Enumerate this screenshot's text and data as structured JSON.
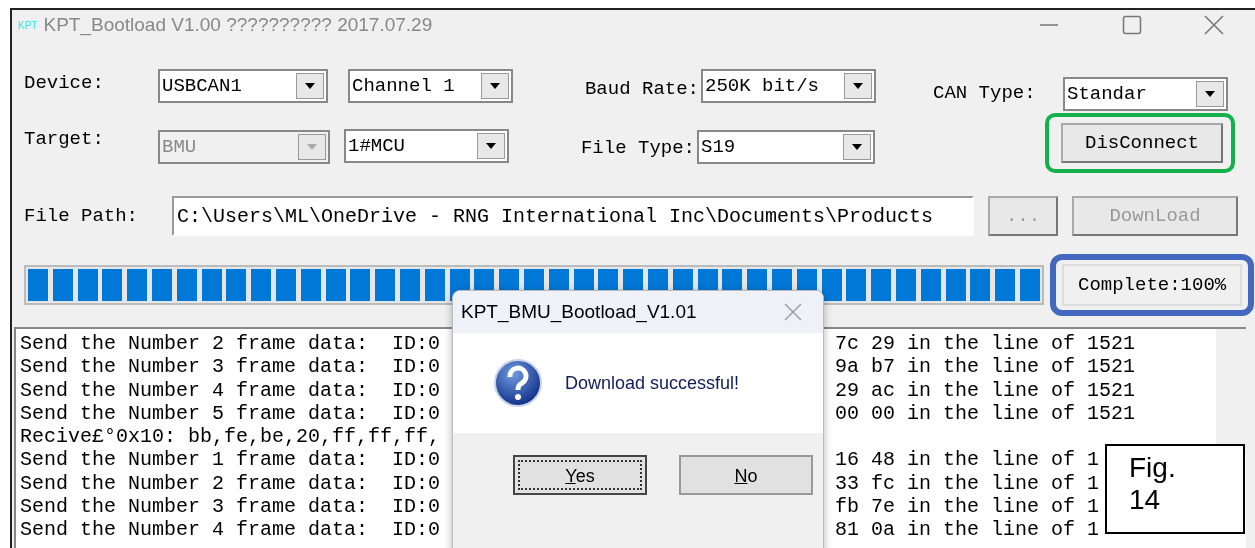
{
  "window": {
    "app_badge": "KPT",
    "title": "KPT_Bootload V1.00 ?????????? 2017.07.29"
  },
  "row1": {
    "label": "Device:",
    "device": {
      "value": "USBCAN1",
      "disabled": false
    },
    "channel": {
      "value": "Channel 1",
      "disabled": false
    },
    "baud_label": "Baud Rate:",
    "baud": {
      "value": "250K bit/s",
      "disabled": false
    },
    "can_label": "CAN Type:",
    "can_type": {
      "value": "Standar",
      "disabled": false
    }
  },
  "row2": {
    "label": "Target:",
    "target": {
      "value": "BMU",
      "disabled": true
    },
    "mcu": {
      "value": "1#MCU",
      "disabled": false
    },
    "file_type_label": "File Type:",
    "file_type": {
      "value": "S19",
      "disabled": false
    },
    "connect_button": {
      "label": "DisConnect",
      "disabled": false,
      "highlighted": true
    }
  },
  "file_path": {
    "label": "File Path:",
    "value": "C:\\Users\\ML\\OneDrive - RNG International Inc\\Documents\\Products",
    "browse_button": {
      "label": "...",
      "disabled": true
    },
    "download_button": {
      "label": "DownLoad",
      "disabled": true
    }
  },
  "progress": {
    "level": 1,
    "status": "Complete:100%",
    "highlighted": true
  },
  "log": [
    {
      "left": "Send the Number 2 frame data:  ID:0",
      "right": "7c 29 in the line of 1521"
    },
    {
      "left": "Send the Number 3 frame data:  ID:0",
      "right": "9a b7 in the line of 1521"
    },
    {
      "left": "Send the Number 4 frame data:  ID:0",
      "right": "29 ac in the line of 1521"
    },
    {
      "left": "Send the Number 5 frame data:  ID:0",
      "right": "00 00 in the line of 1521"
    },
    {
      "left": "Recive£°0x10: bb,fe,be,20,ff,ff,ff,"
    },
    {
      "left": "Send the Number 1 frame data:  ID:0",
      "right": "16 48 in the line of 1"
    },
    {
      "left": "Send the Number 2 frame data:  ID:0",
      "right": "33 fc in the line of 1"
    },
    {
      "left": "Send the Number 3 frame data:  ID:0",
      "right": "fb 7e in the line of 1"
    },
    {
      "left": "Send the Number 4 frame data:  ID:0",
      "right": "81 0a in the line of 1"
    }
  ],
  "dialog": {
    "title": "KPT_BMU_Bootload_V1.01",
    "message": "Download successful!",
    "buttons": [
      {
        "label": "Yes",
        "focused": true
      },
      {
        "label": "No",
        "focused": false
      }
    ]
  },
  "figure_label": "Fig. 14"
}
